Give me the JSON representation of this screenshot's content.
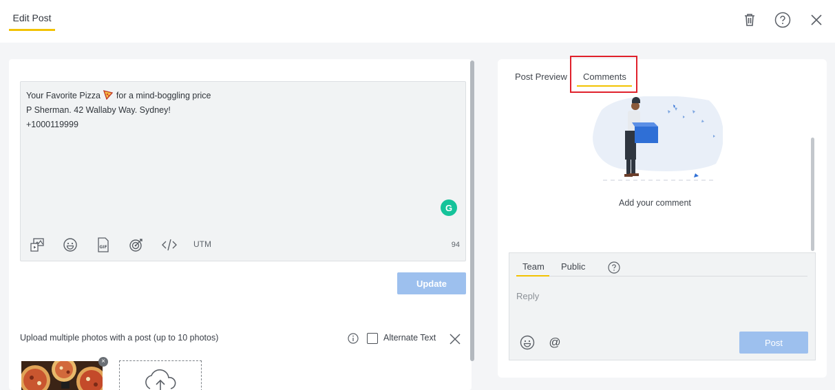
{
  "header": {
    "title": "Edit Post",
    "icons": [
      "trash-icon",
      "help-icon",
      "close-icon"
    ]
  },
  "editor": {
    "line1_before": "Your Favorite Pizza",
    "line1_after": "for a mind-boggling price",
    "line2": "P Sherman. 42 Wallaby Way. Sydney!",
    "line3": "+1000119999",
    "toolbar_icons": [
      "media-icon",
      "emoji-icon",
      "gif-icon",
      "target-icon",
      "code-icon"
    ],
    "utm_label": "UTM",
    "char_count": "94"
  },
  "update_label": "Update",
  "upload": {
    "label": "Upload multiple photos with a post (up to 10 photos)",
    "alt_text_label": "Alternate Text"
  },
  "right": {
    "tabs": [
      "Post Preview",
      "Comments"
    ],
    "active_tab": "Comments",
    "empty_message": "Add your comment",
    "comment_tabs": [
      "Team",
      "Public"
    ],
    "active_comment_tab": "Team",
    "reply_placeholder": "Reply",
    "post_label": "Post"
  },
  "colors": {
    "accent_underline": "#f2c200",
    "button_disabled": "#9dc0ee",
    "highlight": "#e0202a",
    "grammarly": "#15c39a"
  }
}
